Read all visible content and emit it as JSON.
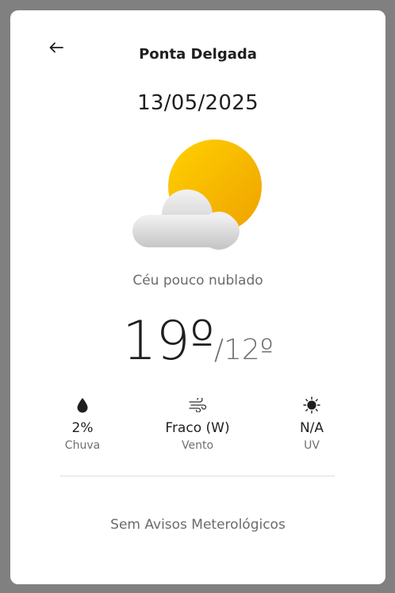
{
  "header": {
    "title": "Ponta Delgada",
    "back_icon": "arrow-left-icon"
  },
  "forecast": {
    "date": "13/05/2025",
    "icon": "partly-cloudy-icon",
    "condition": "Céu pouco nublado",
    "temp_max": "19º",
    "temp_min": "/12º"
  },
  "stats": {
    "rain": {
      "icon": "raindrop-icon",
      "value": "2%",
      "label": "Chuva"
    },
    "wind": {
      "icon": "wind-icon",
      "value": "Fraco (W)",
      "label": "Vento"
    },
    "uv": {
      "icon": "uv-sun-icon",
      "value": "N/A",
      "label": "UV"
    }
  },
  "alerts": {
    "text": "Sem Avisos Meterológicos"
  },
  "colors": {
    "sun": "#F5B800",
    "cloud": "#D9D9D9",
    "background": "#808080"
  }
}
